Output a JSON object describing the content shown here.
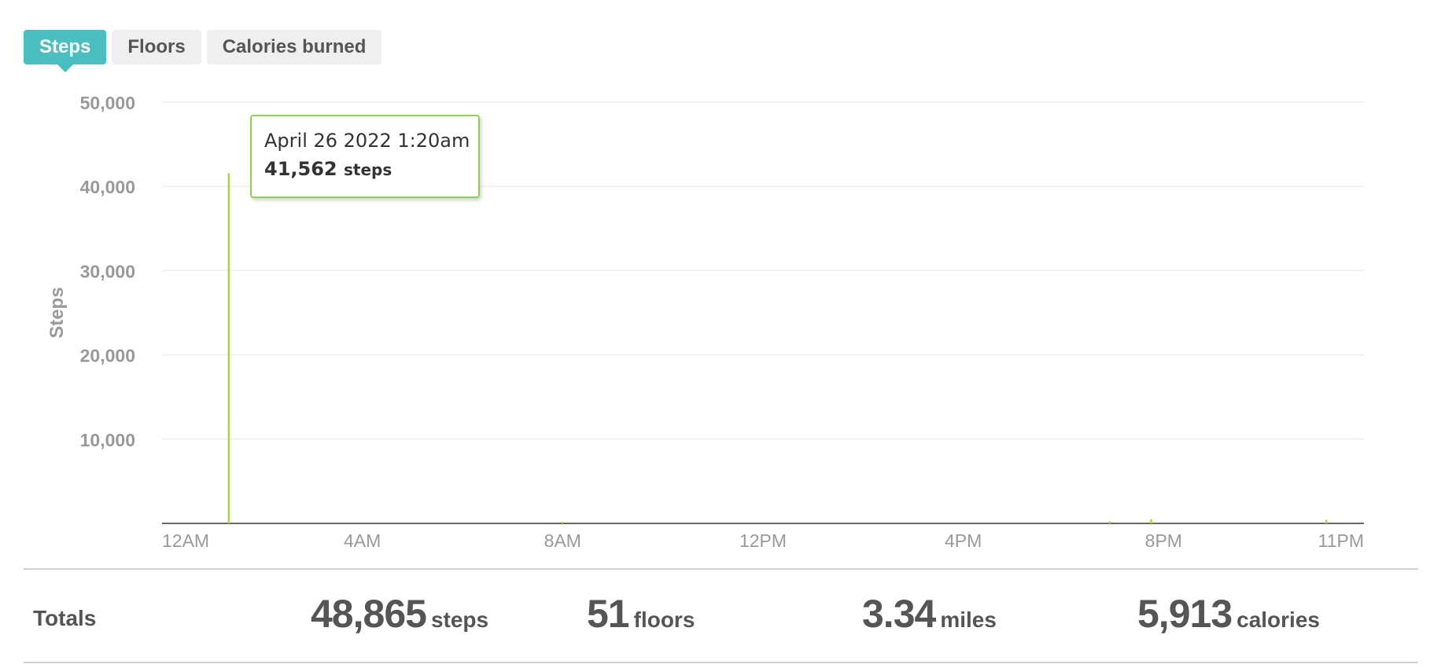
{
  "tabs": [
    {
      "label": "Steps",
      "active": true
    },
    {
      "label": "Floors",
      "active": false
    },
    {
      "label": "Calories burned",
      "active": false
    }
  ],
  "colors": {
    "accent": "#4bbfbf",
    "series": "#a6d930",
    "tooltip_border": "#8fd14f",
    "text": "#555555",
    "axis_text": "#999999",
    "grid": "#eeeeee"
  },
  "tooltip": {
    "date": "April 26 2022 1:20am",
    "value": "41,562",
    "unit": "steps"
  },
  "chart_data": {
    "type": "bar",
    "ylabel": "Steps",
    "ylim": [
      0,
      50000
    ],
    "y_ticks": [
      {
        "value": 10000,
        "label": "10,000"
      },
      {
        "value": 20000,
        "label": "20,000"
      },
      {
        "value": 30000,
        "label": "30,000"
      },
      {
        "value": 40000,
        "label": "40,000"
      },
      {
        "value": 50000,
        "label": "50,000"
      }
    ],
    "x_domain_hours": [
      0,
      24
    ],
    "x_ticks": [
      {
        "hour": 0,
        "label": "12AM"
      },
      {
        "hour": 4,
        "label": "4AM"
      },
      {
        "hour": 8,
        "label": "8AM"
      },
      {
        "hour": 12,
        "label": "12PM"
      },
      {
        "hour": 16,
        "label": "4PM"
      },
      {
        "hour": 20,
        "label": "8PM"
      },
      {
        "hour": 24,
        "label": "11PM"
      }
    ],
    "grid": true,
    "series": [
      {
        "points": [
          {
            "hour": 1.333,
            "value": 41562
          },
          {
            "hour": 8.0,
            "value": 180
          },
          {
            "hour": 18.92,
            "value": 250
          },
          {
            "hour": 19.75,
            "value": 500
          },
          {
            "hour": 23.25,
            "value": 420
          }
        ]
      }
    ]
  },
  "totals": {
    "label": "Totals",
    "steps": {
      "value": "48,865",
      "unit": "steps"
    },
    "floors": {
      "value": "51",
      "unit": "floors"
    },
    "miles": {
      "value": "3.34",
      "unit": "miles"
    },
    "calories": {
      "value": "5,913",
      "unit": "calories"
    }
  }
}
